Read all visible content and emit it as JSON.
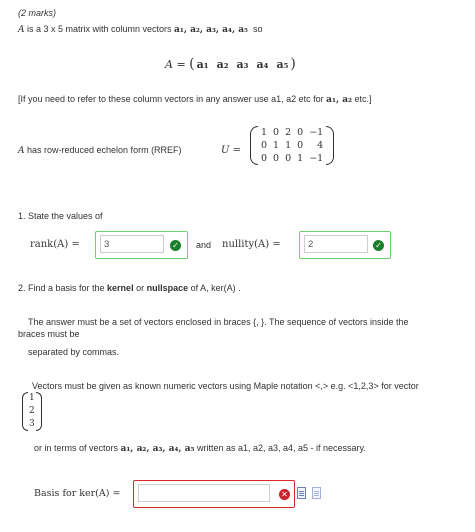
{
  "marks": "(2 marks)",
  "intro": {
    "a": "A",
    "text1": " is a 3 x 5 matrix with column vectors ",
    "vectors": "a₁, a₂, a₃, a₄, a₅",
    "so": "so"
  },
  "equation": {
    "lhs": "A = ",
    "cols": [
      "a₁",
      "a₂",
      "a₃",
      "a₄",
      "a₅"
    ]
  },
  "note": {
    "text": "[If you need to refer to these column vectors in any answer use a1, a2 etc for ",
    "vecs": "a₁, a₂",
    "etc": " etc.]"
  },
  "rref": {
    "label_a": "A",
    "label_text": " has row-reduced echelon form (RREF)",
    "u_label": "U = ",
    "rows": [
      [
        "1",
        "0",
        "2",
        "0",
        "−1"
      ],
      [
        "0",
        "1",
        "1",
        "0",
        "4"
      ],
      [
        "0",
        "0",
        "0",
        "1",
        "−1"
      ]
    ]
  },
  "q1": {
    "text": "1. State the values of",
    "rank_label": "rank(A) =",
    "rank_value": "3",
    "and": "and",
    "nullity_label": "nullity(A) =",
    "nullity_value": "2"
  },
  "q2": {
    "text_pre": "2. Find a basis for the ",
    "kernel": "kernel",
    "or": " or ",
    "nullspace": "nullspace",
    "text_post": " of A, ker(A) .",
    "instr1": "The answer must be a set of vectors enclosed in braces {, }. The sequence of vectors inside the",
    "instr1b": "braces must be",
    "instr2": "separated by commas.",
    "instr3": "Vectors must be given as known numeric vectors using Maple notation <,>  e.g.  <1,2,3> for vector",
    "example_vec": [
      "1",
      "2",
      "3"
    ],
    "instr4_pre": "or in terms of vectors ",
    "instr4_vecs": "a₁, a₂, a₃, a₄, a₅",
    "instr4_post": " written as a1, a2, a3, a4, a5 - if necessary.",
    "basis_label": "Basis for ker(A) =",
    "basis_value": ""
  },
  "colors": {
    "correct": "#1a7f2a",
    "correct_border": "#6fcf6f",
    "error": "#c9232b"
  }
}
